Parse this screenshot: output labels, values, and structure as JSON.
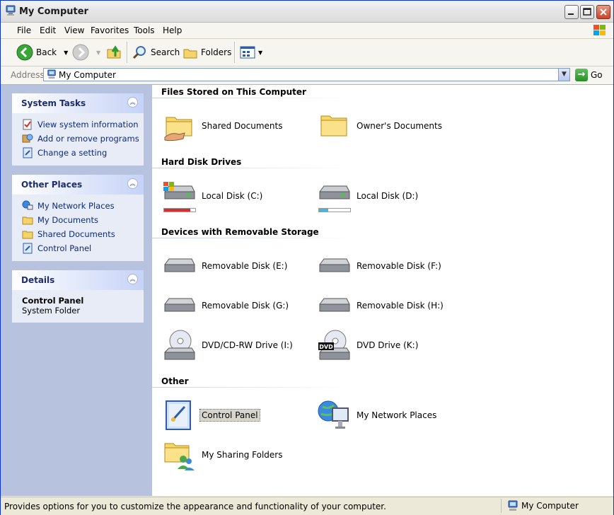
{
  "window": {
    "title": "My Computer"
  },
  "menu": [
    {
      "label": "File"
    },
    {
      "label": "Edit"
    },
    {
      "label": "View"
    },
    {
      "label": "Favorites"
    },
    {
      "label": "Tools"
    },
    {
      "label": "Help"
    }
  ],
  "toolbar": {
    "back_label": "Back",
    "search_label": "Search",
    "folders_label": "Folders"
  },
  "address": {
    "label": "Address",
    "value": "My Computer",
    "go_label": "Go"
  },
  "left": {
    "system_tasks": {
      "title": "System Tasks",
      "items": [
        {
          "label": "View system information",
          "icon": "system-info-icon"
        },
        {
          "label": "Add or remove programs",
          "icon": "add-remove-programs-icon"
        },
        {
          "label": "Change a setting",
          "icon": "control-panel-icon"
        }
      ]
    },
    "other_places": {
      "title": "Other Places",
      "items": [
        {
          "label": "My Network Places",
          "icon": "network-places-icon"
        },
        {
          "label": "My Documents",
          "icon": "folder-icon"
        },
        {
          "label": "Shared Documents",
          "icon": "folder-icon"
        },
        {
          "label": "Control Panel",
          "icon": "control-panel-icon"
        }
      ]
    },
    "details": {
      "title": "Details",
      "name": "Control Panel",
      "type": "System Folder"
    }
  },
  "groups": {
    "files": {
      "title": "Files Stored on This Computer",
      "items": [
        "Shared Documents",
        "Owner's Documents"
      ]
    },
    "hdd": {
      "title": "Hard Disk Drives",
      "items": [
        {
          "label": "Local Disk (C:)",
          "used": 0.85
        },
        {
          "label": "Local Disk (D:)",
          "used": 0.3
        }
      ]
    },
    "removable": {
      "title": "Devices with Removable Storage",
      "items": [
        "Removable Disk (E:)",
        "Removable Disk (F:)",
        "Removable Disk (G:)",
        "Removable Disk (H:)",
        "DVD/CD-RW Drive (I:)",
        "DVD Drive (K:)"
      ]
    },
    "other": {
      "title": "Other",
      "items": [
        "Control Panel",
        "My Network Places",
        "My Sharing Folders"
      ]
    }
  },
  "dvd_badge": "DVD",
  "status": {
    "text": "Provides options for you to customize the appearance and functionality of your computer.",
    "location": "My Computer"
  },
  "colors": {
    "link": "#0c2a80",
    "used_c": "#d03030",
    "used_d": "#49b3d8"
  }
}
